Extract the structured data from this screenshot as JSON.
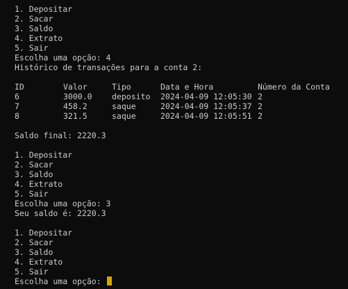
{
  "menu": [
    "1. Depositar",
    "2. Sacar",
    "3. Saldo",
    "4. Extrato",
    "5. Sair"
  ],
  "session": {
    "choice1": "Escolha uma opção: 4",
    "history_title": "Histórico de transações para a conta 2:",
    "table": {
      "headers": [
        "ID",
        "Valor",
        "Tipo",
        "Data e Hora",
        "Número da Conta"
      ],
      "rows": [
        [
          "6",
          "3000.0",
          "deposito",
          "2024-04-09 12:05:30",
          "2"
        ],
        [
          "7",
          "458.2",
          "saque",
          "2024-04-09 12:05:37",
          "2"
        ],
        [
          "8",
          "321.5",
          "saque",
          "2024-04-09 12:05:51",
          "2"
        ]
      ]
    },
    "final_balance": "Saldo final: 2220.3",
    "choice2": "Escolha uma opção: 3",
    "balance_msg": "Seu saldo é: 2220.3",
    "prompt": "Escolha uma opção: "
  },
  "colors": {
    "background": "#0c0c0c",
    "text": "#cccccc",
    "cursor": "#d9a400"
  }
}
